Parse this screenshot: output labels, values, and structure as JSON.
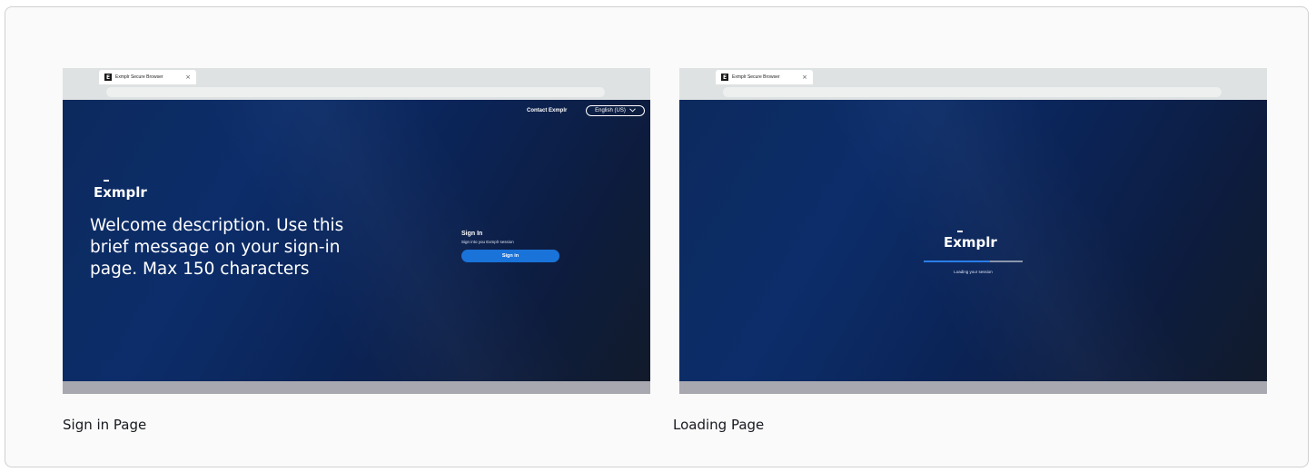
{
  "browser": {
    "tab_title": "Exmplr Secure Browser",
    "tab_close": "×",
    "favicon_letter": "E"
  },
  "sign_in_page": {
    "contact_link": "Contact Exmplr",
    "language": "English (US)",
    "logo": "Exmplr",
    "welcome": "Welcome description. Use this brief message on your sign-in page. Max 150 characters",
    "signin_title": "Sign In",
    "signin_subtitle": "Sign into you Exmplr session",
    "signin_button": "Sign in",
    "caption": "Sign in Page"
  },
  "loading_page": {
    "logo": "Exmplr",
    "progress_fraction": 0.67,
    "loading_text": "Loading your session",
    "caption": "Loading Page"
  },
  "colors": {
    "primary_button": "#1a73d9",
    "page_background": "#0c2d6a",
    "progress_fill": "#2a7ee8"
  }
}
